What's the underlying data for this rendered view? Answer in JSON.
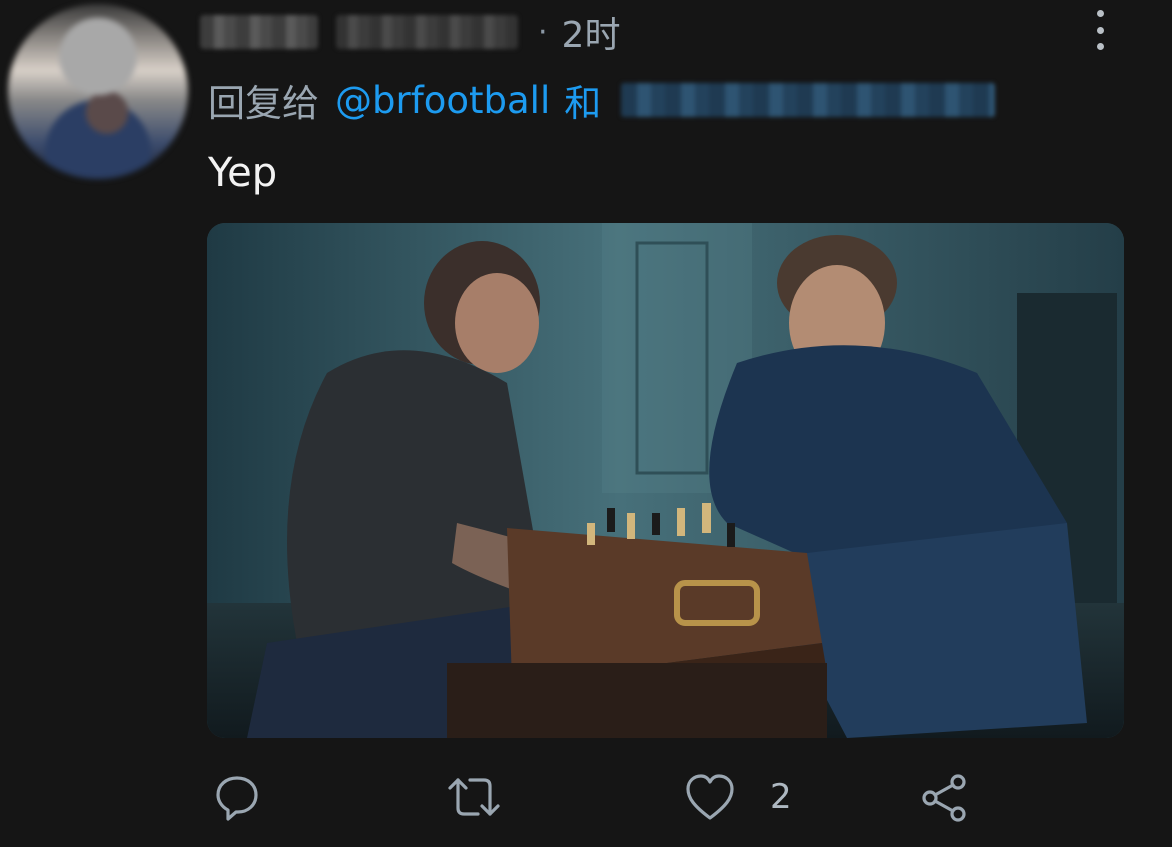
{
  "tweet": {
    "time": "2时",
    "separator": "·",
    "reply_prefix": "回复给",
    "mention": "@brfootball",
    "and_word": "和",
    "text": "Yep"
  },
  "actions": {
    "reply_icon": "reply-icon",
    "retweet_icon": "retweet-icon",
    "like_icon": "heart-icon",
    "like_count": "2",
    "share_icon": "share-icon"
  },
  "colors": {
    "background": "#151515",
    "accent": "#1d9bf0",
    "secondary_text": "#9aa6b1"
  }
}
